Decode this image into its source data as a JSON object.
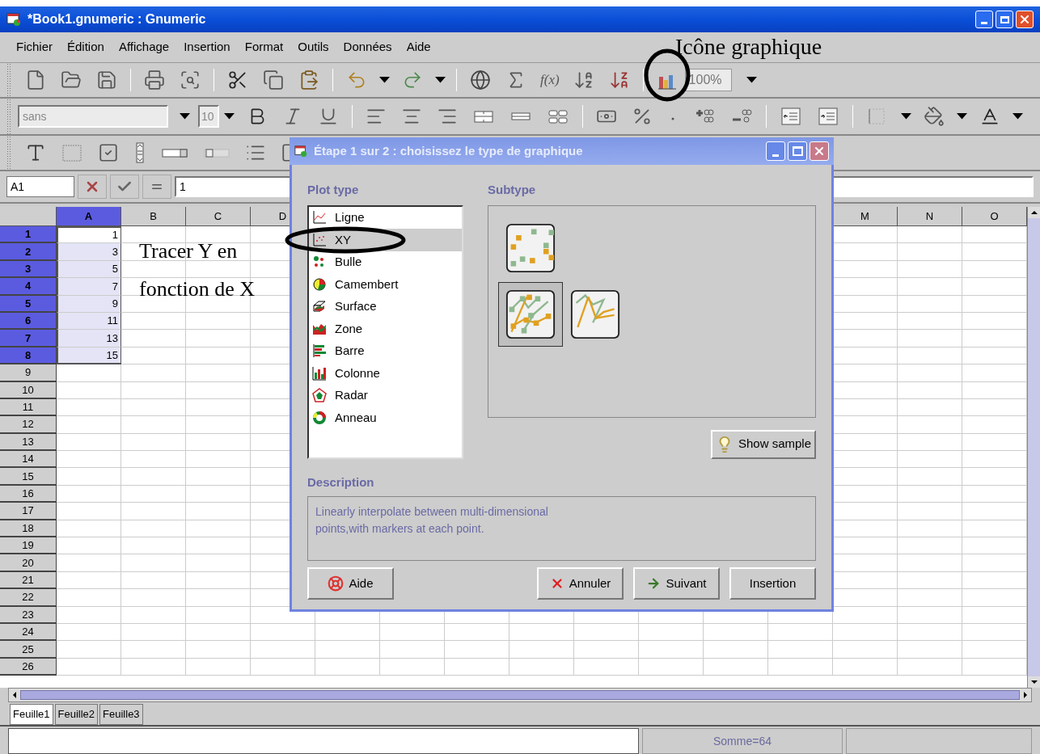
{
  "window": {
    "title": "*Book1.gnumeric : Gnumeric"
  },
  "menu": [
    "Fichier",
    "Édition",
    "Affichage",
    "Insertion",
    "Format",
    "Outils",
    "Données",
    "Aide"
  ],
  "toolbar": {
    "function_label": "f(x)",
    "zoom": "100%",
    "font": "sans",
    "font_size": "10"
  },
  "formula_bar": {
    "cell": "A1",
    "value": "1"
  },
  "sheet": {
    "columns": [
      {
        "label": "A",
        "selected": true
      },
      {
        "label": "B",
        "selected": false
      },
      {
        "label": "C",
        "selected": false
      },
      {
        "label": "D",
        "selected": false
      },
      {
        "label": "M",
        "selected": false
      },
      {
        "label": "N",
        "selected": false
      },
      {
        "label": "O",
        "selected": false
      }
    ],
    "rows": [
      {
        "label": "1",
        "selected": true,
        "cells": [
          {
            "value": "1",
            "active": true
          }
        ]
      },
      {
        "label": "2",
        "selected": true,
        "cells": [
          {
            "value": "3",
            "active": false
          }
        ]
      },
      {
        "label": "3",
        "selected": true,
        "cells": [
          {
            "value": "5",
            "active": false
          }
        ]
      },
      {
        "label": "4",
        "selected": true,
        "cells": [
          {
            "value": "7",
            "active": false
          }
        ]
      },
      {
        "label": "5",
        "selected": true,
        "cells": [
          {
            "value": "9",
            "active": false
          }
        ]
      },
      {
        "label": "6",
        "selected": true,
        "cells": [
          {
            "value": "11",
            "active": false
          }
        ]
      },
      {
        "label": "7",
        "selected": true,
        "cells": [
          {
            "value": "13",
            "active": false
          }
        ]
      },
      {
        "label": "8",
        "selected": true,
        "cells": [
          {
            "value": "15",
            "active": false
          }
        ]
      },
      {
        "label": "9",
        "selected": false
      },
      {
        "label": "10",
        "selected": false
      },
      {
        "label": "11",
        "selected": false
      },
      {
        "label": "12",
        "selected": false
      },
      {
        "label": "13",
        "selected": false
      },
      {
        "label": "14",
        "selected": false
      },
      {
        "label": "15",
        "selected": false
      },
      {
        "label": "16",
        "selected": false
      },
      {
        "label": "17",
        "selected": false
      },
      {
        "label": "18",
        "selected": false
      },
      {
        "label": "19",
        "selected": false
      },
      {
        "label": "20",
        "selected": false
      },
      {
        "label": "21",
        "selected": false
      },
      {
        "label": "22",
        "selected": false
      },
      {
        "label": "23",
        "selected": false
      },
      {
        "label": "24",
        "selected": false
      },
      {
        "label": "25",
        "selected": false
      },
      {
        "label": "26",
        "selected": false
      }
    ]
  },
  "sheet_tabs": [
    {
      "label": "Feuille1",
      "selected": true
    },
    {
      "label": "Feuille2",
      "selected": false
    },
    {
      "label": "Feuille3",
      "selected": false
    }
  ],
  "status_bar": {
    "sum": "Somme=64"
  },
  "annotations": [
    "Icône graphique",
    "Tracer Y en",
    "fonction de X"
  ],
  "dialog": {
    "title": "Étape 1 sur 2 : choisissez le type de graphique",
    "plot_type_label": "Plot type",
    "plot_types": [
      {
        "kind": "line",
        "label": "Ligne",
        "selected": false
      },
      {
        "kind": "xy",
        "label": "XY",
        "selected": true
      },
      {
        "kind": "bubble",
        "label": "Bulle",
        "selected": false
      },
      {
        "kind": "pie",
        "label": "Camembert",
        "selected": false
      },
      {
        "kind": "surface",
        "label": "Surface",
        "selected": false
      },
      {
        "kind": "area",
        "label": "Zone",
        "selected": false
      },
      {
        "kind": "bar",
        "label": "Barre",
        "selected": false
      },
      {
        "kind": "column",
        "label": "Colonne",
        "selected": false
      },
      {
        "kind": "radar",
        "label": "Radar",
        "selected": false
      },
      {
        "kind": "ring",
        "label": "Anneau",
        "selected": false
      }
    ],
    "subtype_label": "Subtype",
    "subtypes": [
      {
        "kind": "markers",
        "selected": false
      },
      {
        "kind": "lines_markers",
        "selected": true
      },
      {
        "kind": "lines",
        "selected": false
      }
    ],
    "show_sample": "Show sample",
    "description_label": "Description",
    "description": "Linearly interpolate between multi-dimensional\npoints,with markers at each point.",
    "buttons": [
      {
        "kind": "help",
        "label": "Aide"
      },
      {
        "kind": "cancel",
        "label": "Annuler"
      },
      {
        "kind": "next",
        "label": "Suivant"
      },
      {
        "kind": "insert",
        "label": "Insertion"
      }
    ]
  }
}
